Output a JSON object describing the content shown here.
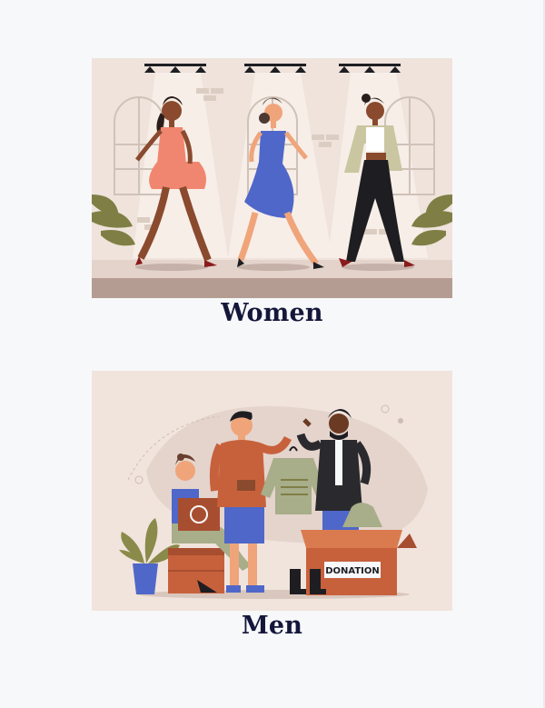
{
  "categories": [
    {
      "id": "women",
      "label": "Women",
      "image": "fashion-runway-illustration"
    },
    {
      "id": "men",
      "label": "Men",
      "image": "clothing-donation-illustration"
    }
  ],
  "donation_box_text": "DONATION",
  "colors": {
    "background": "#f7f8fa",
    "label": "#14163a",
    "illustration_bg": "#f1e4dc"
  }
}
